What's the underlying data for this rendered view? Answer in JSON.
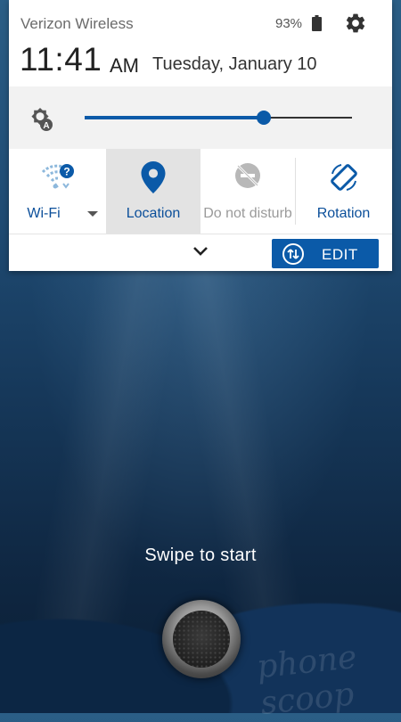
{
  "status_bar": {
    "carrier": "Verizon Wireless",
    "battery_percent": "93%",
    "icons": [
      "battery-icon",
      "settings-gear-icon"
    ]
  },
  "clock": {
    "time": "11:41",
    "ampm": "AM",
    "date": "Tuesday, January 10"
  },
  "brightness": {
    "auto_icon": "auto-brightness-icon",
    "level": 0.67
  },
  "quick_tiles": [
    {
      "label": "Wi-Fi",
      "icon": "wifi-question-icon",
      "active": false
    },
    {
      "label": "Location",
      "icon": "location-pin-icon",
      "active": true
    },
    {
      "label": "Do not disturb",
      "icon": "do-not-disturb-icon",
      "active": false
    },
    {
      "label": "Rotation",
      "icon": "rotation-icon",
      "active": true
    }
  ],
  "panel_footer": {
    "expand_icon": "chevron-down-icon",
    "edit_label": "EDIT",
    "edit_icon": "swap-arrows-icon"
  },
  "lockscreen": {
    "hint": "Swipe to start",
    "watermark": "phone scoop"
  },
  "colors": {
    "accent": "#0b5aa8",
    "tile_selected_bg": "#e3e3e3"
  }
}
